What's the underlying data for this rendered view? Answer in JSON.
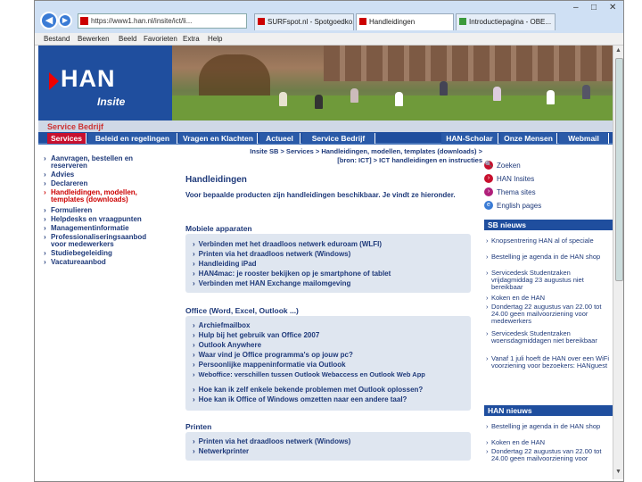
{
  "browser": {
    "address": "https://www1.han.nl/insite/ict/li...",
    "tabs": [
      {
        "label": "SURFspot.nl - Spotgoedko...",
        "active": false
      },
      {
        "label": "Handleidingen",
        "active": true
      },
      {
        "label": "Introductiepagina - OBE...",
        "active": false
      }
    ],
    "menu": [
      "Bestand",
      "Bewerken",
      "Beeld",
      "Favorieten",
      "Extra",
      "Help"
    ],
    "controls": {
      "min": "–",
      "max": "□",
      "close": "✕"
    }
  },
  "header": {
    "logo_text": "HAN",
    "logo_sub": "Insite",
    "section_label": "Service Bedrijf"
  },
  "nav": [
    {
      "label": "Services",
      "active": true
    },
    {
      "label": "Beleid en regelingen",
      "active": false
    },
    {
      "label": "Vragen en Klachten",
      "active": false
    },
    {
      "label": "Actueel",
      "active": false
    },
    {
      "label": "Service Bedrijf",
      "active": false
    },
    {
      "label": "HAN-Scholar",
      "active": false
    },
    {
      "label": "Onze Mensen",
      "active": false
    },
    {
      "label": "Webmail",
      "active": false
    }
  ],
  "left_menu": [
    {
      "label": "Aanvragen, bestellen en reserveren",
      "active": false
    },
    {
      "label": "Advies",
      "active": false
    },
    {
      "label": "Declareren",
      "active": false
    },
    {
      "label": "Handleidingen, modellen, templates (downloads)",
      "active": true
    },
    {
      "label": "Formulieren",
      "active": false
    },
    {
      "label": "Helpdesks en vraagpunten",
      "active": false
    },
    {
      "label": "Managementinformatie",
      "active": false
    },
    {
      "label": "Professionaliseringsaanbod voor medewerkers",
      "active": false
    },
    {
      "label": "Studiebegeleiding",
      "active": false
    },
    {
      "label": "Vacatureaanbod",
      "active": false
    }
  ],
  "breadcrumb": "Insite SB > Services > Handleidingen, modellen, templates (downloads) > [bron: ICT] > ICT handleidingen en instructies",
  "main": {
    "title": "Handleidingen",
    "intro": "Voor bepaalde producten zijn handleidingen beschikbaar. Je vindt ze hieronder.",
    "sections": [
      {
        "heading": "Mobiele apparaten",
        "items": [
          "Verbinden met het draadloos netwerk eduroam (WLFI)",
          "Printen via het draadloos netwerk (Windows)",
          "Handleiding iPad",
          "HAN4mac: je rooster bekijken op je smartphone of tablet",
          "Verbinden met HAN Exchange mailomgeving"
        ]
      },
      {
        "heading": "Office (Word, Excel, Outlook ...)",
        "items": [
          "Archiefmailbox",
          "Hulp bij het gebruik van Office 2007",
          "Outlook Anywhere",
          "Waar vind je Office programma's op jouw pc?",
          "Persoonlijke mappeninformatie via Outlook",
          "Webofficе: verschillen tussen Outlook Webaccess en Outlook Web App",
          "Hoe kan ik zelf enkele bekende problemen met Outlook oplossen?",
          "Hoe kan ik Office of Windows omzetten naar een andere taal?"
        ]
      },
      {
        "heading": "Printen",
        "items": [
          "Printen via het draadloos netwerk (Windows)",
          "Netwerkprinter"
        ]
      }
    ]
  },
  "quick_links": [
    {
      "label": "Zoeken",
      "color": "#c8102e"
    },
    {
      "label": "HAN Insites",
      "color": "#c8102e"
    },
    {
      "label": "Thema sites",
      "color": "#b0207a"
    },
    {
      "label": "English pages",
      "color": "#3a7bd5"
    }
  ],
  "news_sb": {
    "heading": "SB nieuws",
    "items": [
      "Knopsentrering HAN al of speciale",
      "Bestelling je agenda in de HAN shop",
      "Servicedesk Studentzaken vrijdagmiddag 23 augustus niet bereikbaar",
      "Koken en de HAN",
      "Dondertag 22 augustus van 22.00 tot 24.00 geen mailvoorziening voor medewerkers",
      "Servicedesk Studentzaken woensdagmiddagen niet bereikbaar",
      "Vanaf 1 juli hoeft de HAN over een WiFi voorziening voor bezoekers: HANguest"
    ]
  },
  "news_han": {
    "heading": "HAN nieuws",
    "items": [
      "Bestelling je agenda in de HAN shop",
      "Koken en de HAN",
      "Dondertag 22 augustus van 22.00 tot 24.00 geen mailvoorziening voor"
    ]
  }
}
